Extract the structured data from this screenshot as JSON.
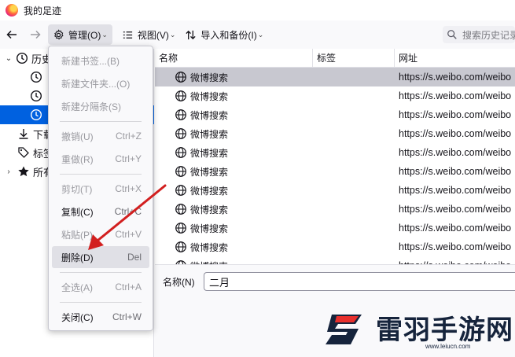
{
  "window": {
    "title": "我的足迹"
  },
  "toolbar": {
    "manage_label": "管理(O)",
    "view_label": "视图(V)",
    "import_label": "导入和备份(I)",
    "search_placeholder": "搜索历史记录"
  },
  "sidebar": {
    "items": [
      {
        "label": "历史",
        "icon": "clock-icon",
        "expanded": true
      },
      {
        "label": "",
        "icon": "clock-icon"
      },
      {
        "label": "",
        "icon": "clock-icon"
      },
      {
        "label": "",
        "icon": "clock-icon",
        "selected": true
      },
      {
        "label": "下载",
        "icon": "download-icon"
      },
      {
        "label": "标签",
        "icon": "tag-icon"
      },
      {
        "label": "所有",
        "icon": "star-icon"
      }
    ]
  },
  "table": {
    "columns": [
      "名称",
      "标签",
      "网址"
    ],
    "rows": [
      {
        "name": "微博搜索",
        "tags": "",
        "url": "https://s.weibo.com/weibo"
      },
      {
        "name": "微博搜索",
        "tags": "",
        "url": "https://s.weibo.com/weibo"
      },
      {
        "name": "微博搜索",
        "tags": "",
        "url": "https://s.weibo.com/weibo"
      },
      {
        "name": "微博搜索",
        "tags": "",
        "url": "https://s.weibo.com/weibo"
      },
      {
        "name": "微博搜索",
        "tags": "",
        "url": "https://s.weibo.com/weibo"
      },
      {
        "name": "微博搜索",
        "tags": "",
        "url": "https://s.weibo.com/weibo"
      },
      {
        "name": "微博搜索",
        "tags": "",
        "url": "https://s.weibo.com/weibo"
      },
      {
        "name": "微博搜索",
        "tags": "",
        "url": "https://s.weibo.com/weibo"
      },
      {
        "name": "微博搜索",
        "tags": "",
        "url": "https://s.weibo.com/weibo"
      },
      {
        "name": "微博搜索",
        "tags": "",
        "url": "https://s.weibo.com/weibo"
      },
      {
        "name": "微博搜索",
        "tags": "",
        "url": "https://s.weibo.com/weibo"
      }
    ]
  },
  "details": {
    "name_label": "名称(N)",
    "name_value": "二月"
  },
  "menu": {
    "new_bookmark": {
      "label": "新建书签...(B)"
    },
    "new_folder": {
      "label": "新建文件夹...(O)"
    },
    "new_separator": {
      "label": "新建分隔条(S)"
    },
    "undo": {
      "label": "撤销(U)",
      "shortcut": "Ctrl+Z"
    },
    "redo": {
      "label": "重做(R)",
      "shortcut": "Ctrl+Y"
    },
    "cut": {
      "label": "剪切(T)",
      "shortcut": "Ctrl+X"
    },
    "copy": {
      "label": "复制(C)",
      "shortcut": "Ctrl+C"
    },
    "paste": {
      "label": "粘贴(P)",
      "shortcut": "Ctrl+V"
    },
    "delete": {
      "label": "删除(D)",
      "shortcut": "Del"
    },
    "select_all": {
      "label": "全选(A)",
      "shortcut": "Ctrl+A"
    },
    "close": {
      "label": "关闭(C)",
      "shortcut": "Ctrl+W"
    }
  },
  "watermark": {
    "brand": "雷羽手游网",
    "url": "www.leiucn.com"
  },
  "colors": {
    "selection": "#0061e0",
    "arrow": "#d21f1f",
    "watermark_blue": "#16243c",
    "watermark_red": "#e8302d"
  }
}
